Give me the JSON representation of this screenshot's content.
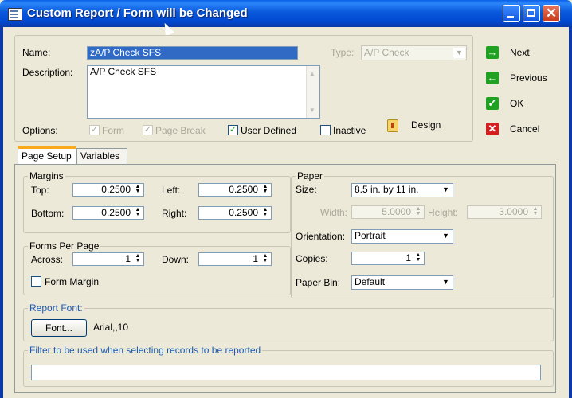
{
  "window": {
    "title": "Custom Report / Form will be Changed"
  },
  "form": {
    "name_label": "Name:",
    "name_value": "zA/P Check SFS",
    "type_label": "Type:",
    "type_value": "A/P Check",
    "description_label": "Description:",
    "description_value": "A/P Check SFS",
    "options_label": "Options:",
    "options": [
      {
        "label": "Form",
        "checked": true,
        "enabled": false
      },
      {
        "label": "Page Break",
        "checked": true,
        "enabled": false
      },
      {
        "label": "User Defined",
        "checked": true,
        "enabled": true
      },
      {
        "label": "Inactive",
        "checked": false,
        "enabled": true
      }
    ],
    "design_label": "Design"
  },
  "side_buttons": [
    {
      "label": "Next",
      "icon": "arrow-right-icon",
      "color": "#21a121"
    },
    {
      "label": "Previous",
      "icon": "arrow-left-icon",
      "color": "#21a121"
    },
    {
      "label": "OK",
      "icon": "checkmark-icon",
      "color": "#21a121"
    },
    {
      "label": "Cancel",
      "icon": "x-icon",
      "color": "#d22020"
    }
  ],
  "tabs": [
    {
      "label": "Page Setup",
      "active": true
    },
    {
      "label": "Variables",
      "active": false
    }
  ],
  "margins": {
    "group_label": "Margins",
    "top_label": "Top:",
    "top_value": "0.2500",
    "left_label": "Left:",
    "left_value": "0.2500",
    "bottom_label": "Bottom:",
    "bottom_value": "0.2500",
    "right_label": "Right:",
    "right_value": "0.2500"
  },
  "forms_per_page": {
    "group_label": "Forms Per Page",
    "across_label": "Across:",
    "across_value": "1",
    "down_label": "Down:",
    "down_value": "1",
    "form_margin_label": "Form Margin",
    "form_margin_checked": false
  },
  "paper": {
    "group_label": "Paper",
    "size_label": "Size:",
    "size_value": "8.5 in. by 11 in.",
    "width_label": "Width:",
    "width_value": "5.0000",
    "height_label": "Height:",
    "height_value": "3.0000",
    "orientation_label": "Orientation:",
    "orientation_value": "Portrait",
    "copies_label": "Copies:",
    "copies_value": "1",
    "bin_label": "Paper Bin:",
    "bin_value": "Default"
  },
  "report_font": {
    "group_label": "Report Font:",
    "button_label": "Font...",
    "value": "Arial,,10"
  },
  "filter": {
    "group_label": "Filter to be used when selecting records to be reported",
    "value": ""
  }
}
